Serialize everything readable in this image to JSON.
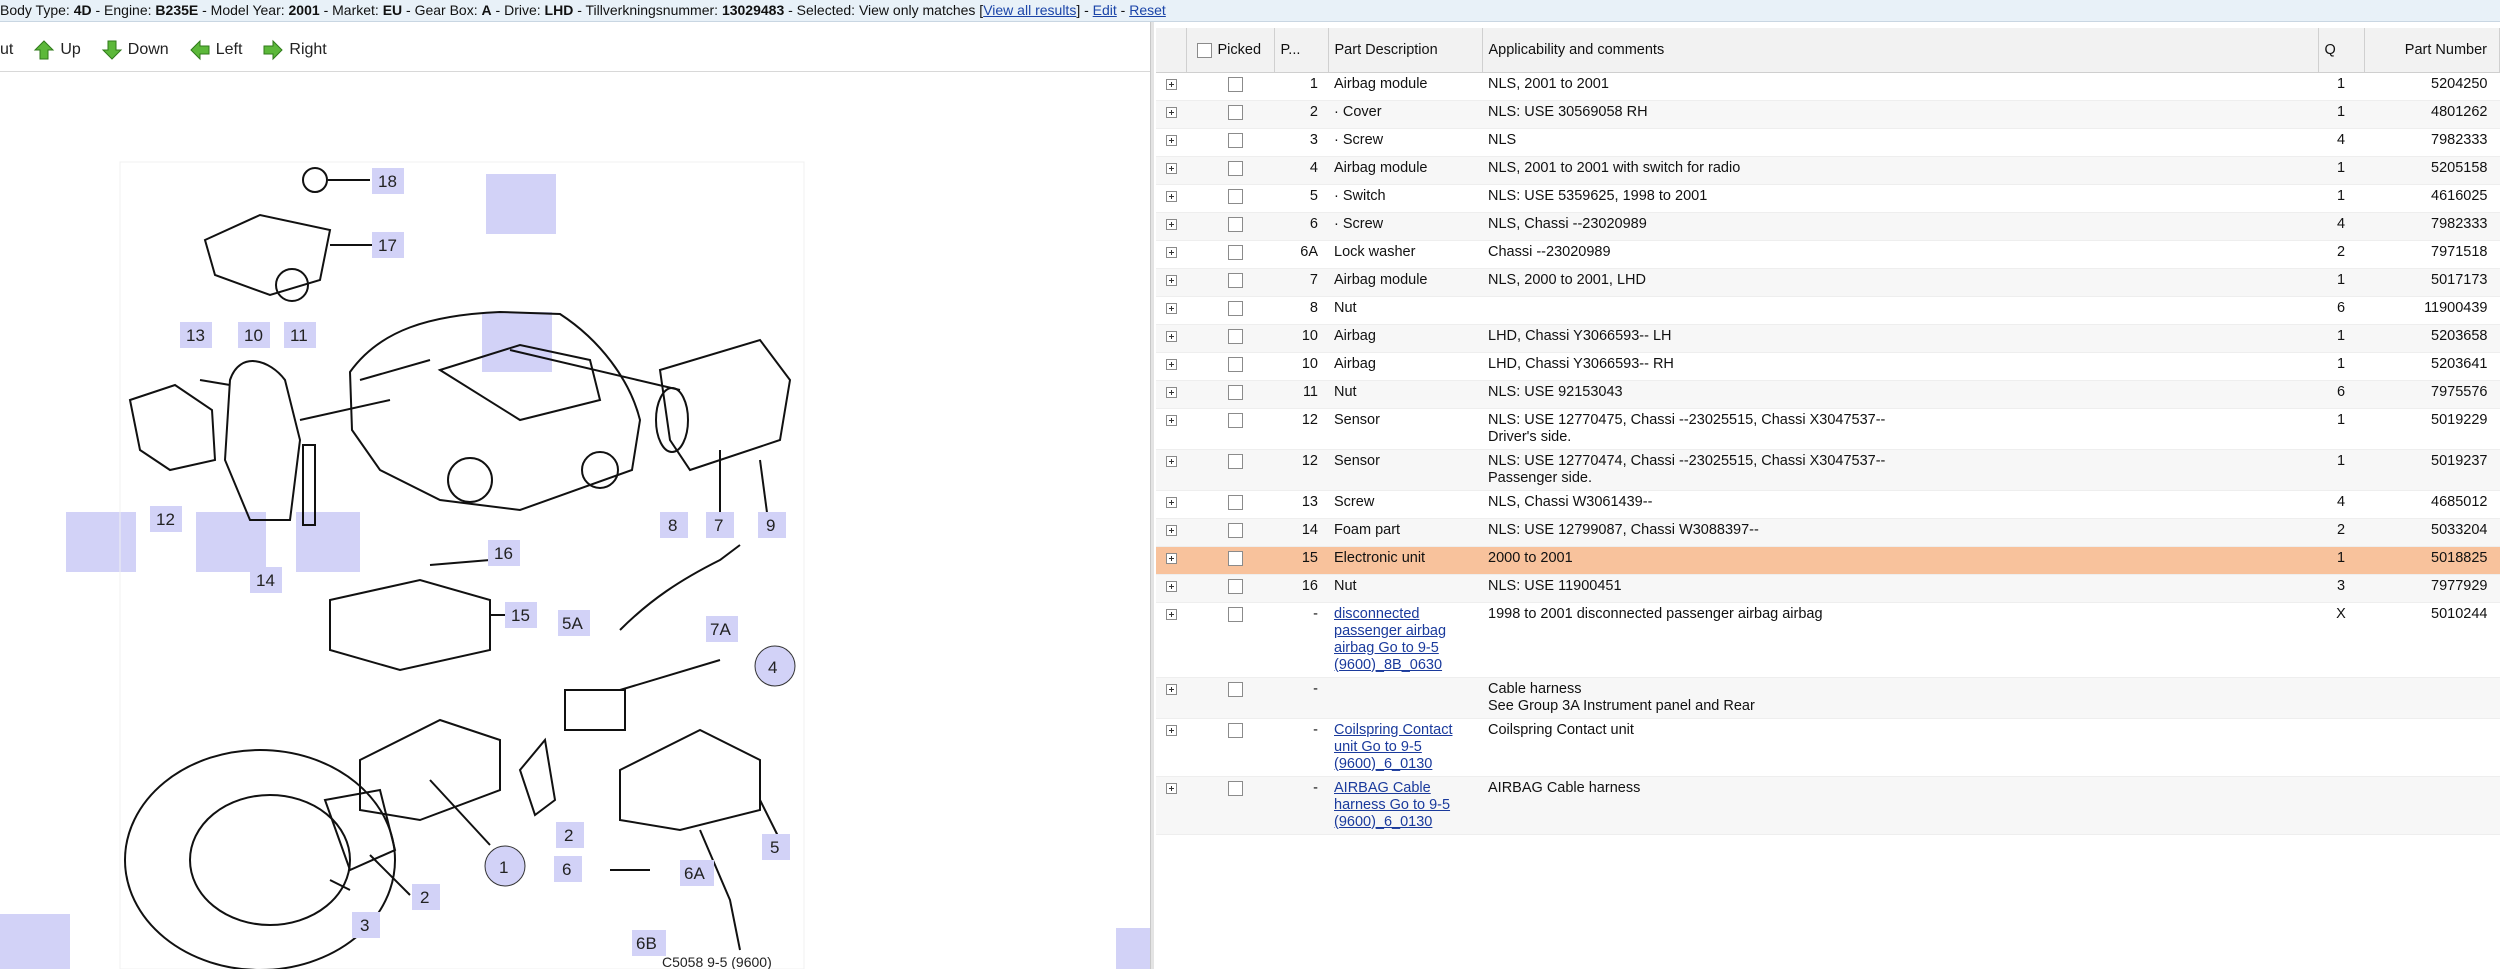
{
  "infobar": {
    "text": "Body Type: 4D - Engine: B235E - Model Year: 2001 - Market: EU - Gear Box: A - Drive: LHD - Tillverkningsnummer: 13029483 - Selected: View only matches",
    "body_type_label": "Body Type:",
    "body_type": "4D",
    "engine_label": "- Engine:",
    "engine": "B235E",
    "model_year_label": "- Model Year:",
    "model_year": "2001",
    "market_label": "- Market:",
    "market": "EU",
    "gear_box_label": "- Gear Box:",
    "gear_box": "A",
    "drive_label": "- Drive:",
    "drive": "LHD",
    "tillv_label": "- Tillverkningsnummer:",
    "tillv": "13029483",
    "selected_label": "- Selected:",
    "selected_value": "View only matches",
    "view_all_link": "View all results",
    "edit_link": "Edit",
    "reset_link": "Reset"
  },
  "toolbar": {
    "cut_label": "ut",
    "up_label": "Up",
    "down_label": "Down",
    "left_label": "Left",
    "right_label": "Right"
  },
  "diagram": {
    "caption": "C5058 9-5 (9600)",
    "callouts": [
      "18",
      "17",
      "13",
      "10",
      "11",
      "12",
      "14",
      "16",
      "15",
      "8",
      "7",
      "9",
      "7A",
      "5A",
      "4",
      "1",
      "2",
      "3",
      "6",
      "6A",
      "5",
      "6B"
    ]
  },
  "table": {
    "headers": {
      "picked": "Picked",
      "pos": "P...",
      "description": "Part Description",
      "comments": "Applicability and comments",
      "qty": "Q",
      "part_number": "Part Number"
    },
    "rows": [
      {
        "pos": "1",
        "desc": "Airbag module",
        "comment": "NLS, 2001 to 2001",
        "comment2": "",
        "qty": "1",
        "pn": "5204250"
      },
      {
        "pos": "2",
        "desc": "· Cover",
        "comment": "NLS: USE 30569058 RH",
        "comment2": "",
        "qty": "1",
        "pn": "4801262"
      },
      {
        "pos": "3",
        "desc": "· Screw",
        "comment": "NLS",
        "comment2": "",
        "qty": "4",
        "pn": "7982333"
      },
      {
        "pos": "4",
        "desc": "Airbag module",
        "comment": "NLS, 2001 to 2001 with switch for radio",
        "comment2": "",
        "qty": "1",
        "pn": "5205158"
      },
      {
        "pos": "5",
        "desc": "· Switch",
        "comment": "NLS: USE 5359625, 1998 to 2001",
        "comment2": "",
        "qty": "1",
        "pn": "4616025"
      },
      {
        "pos": "6",
        "desc": "· Screw",
        "comment": "NLS, Chassi --23020989",
        "comment2": "",
        "qty": "4",
        "pn": "7982333"
      },
      {
        "pos": "6A",
        "desc": "Lock washer",
        "comment": "Chassi --23020989",
        "comment2": "",
        "qty": "2",
        "pn": "7971518"
      },
      {
        "pos": "7",
        "desc": "Airbag module",
        "comment": "NLS, 2000 to 2001, LHD",
        "comment2": "",
        "qty": "1",
        "pn": "5017173"
      },
      {
        "pos": "8",
        "desc": "Nut",
        "comment": "",
        "comment2": "",
        "qty": "6",
        "pn": "11900439"
      },
      {
        "pos": "10",
        "desc": "Airbag",
        "comment": "LHD, Chassi Y3066593-- LH",
        "comment2": "",
        "qty": "1",
        "pn": "5203658"
      },
      {
        "pos": "10",
        "desc": "Airbag",
        "comment": "LHD, Chassi Y3066593-- RH",
        "comment2": "",
        "qty": "1",
        "pn": "5203641"
      },
      {
        "pos": "11",
        "desc": "Nut",
        "comment": "NLS: USE 92153043",
        "comment2": "",
        "qty": "6",
        "pn": "7975576"
      },
      {
        "pos": "12",
        "desc": "Sensor",
        "comment": "NLS: USE 12770475, Chassi --23025515, Chassi X3047537--",
        "comment2": "Driver's side.",
        "qty": "1",
        "pn": "5019229"
      },
      {
        "pos": "12",
        "desc": "Sensor",
        "comment": "NLS: USE 12770474, Chassi --23025515, Chassi X3047537--",
        "comment2": "Passenger side.",
        "qty": "1",
        "pn": "5019237"
      },
      {
        "pos": "13",
        "desc": "Screw",
        "comment": "NLS, Chassi W3061439--",
        "comment2": "",
        "qty": "4",
        "pn": "4685012"
      },
      {
        "pos": "14",
        "desc": "Foam part",
        "comment": "NLS: USE 12799087, Chassi W3088397--",
        "comment2": "",
        "qty": "2",
        "pn": "5033204"
      },
      {
        "pos": "15",
        "desc": "Electronic unit",
        "comment": "2000 to 2001",
        "comment2": "",
        "qty": "1",
        "pn": "5018825",
        "selected": true
      },
      {
        "pos": "16",
        "desc": "Nut",
        "comment": "NLS: USE 11900451",
        "comment2": "",
        "qty": "3",
        "pn": "7977929"
      },
      {
        "pos": "-",
        "desc": "disconnected passenger airbag airbag Go to 9-5 (9600)_8B_0630",
        "desc_link": true,
        "comment": "1998 to 2001 disconnected passenger airbag airbag",
        "comment2": "",
        "qty": "X",
        "pn": "5010244"
      },
      {
        "pos": "-",
        "desc": "",
        "comment": "Cable harness",
        "comment2": "See Group 3A Instrument panel and Rear",
        "qty": "",
        "pn": ""
      },
      {
        "pos": "-",
        "desc": "Coilspring Contact unit Go to 9-5 (9600)_6_0130",
        "desc_link": true,
        "comment": "Coilspring Contact unit",
        "comment2": "",
        "qty": "",
        "pn": ""
      },
      {
        "pos": "-",
        "desc": "AIRBAG Cable harness Go to 9-5 (9600)_6_0130",
        "desc_link": true,
        "comment": "AIRBAG Cable harness",
        "comment2": "",
        "qty": "",
        "pn": ""
      }
    ]
  },
  "colors": {
    "selected_row": "#f8c29c",
    "callout_fill": "#d2d2f7",
    "link": "#1a3a9c",
    "infobar_bg": "#e8f1f8"
  }
}
